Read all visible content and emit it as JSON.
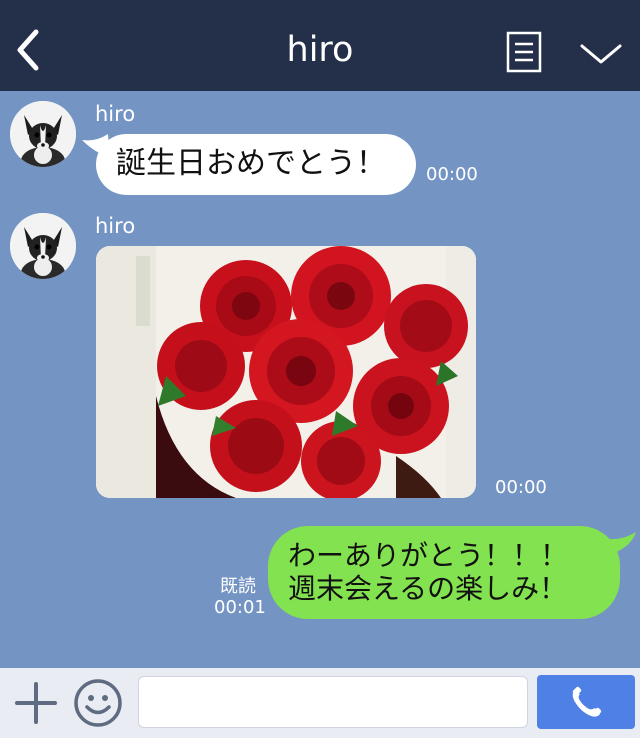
{
  "header": {
    "title": "hiro",
    "back_icon": "chevron-left-icon",
    "menu_icon": "list-icon",
    "collapse_icon": "chevron-down-icon",
    "background": "#243049"
  },
  "chat": {
    "background": "#7494c4",
    "messages": [
      {
        "sender": "hiro",
        "text": "誕生日おめでとう！",
        "time": "00:00"
      },
      {
        "sender": "hiro",
        "image": "red-roses-bouquet",
        "time": "00:00"
      },
      {
        "direction": "outgoing",
        "line1": "わーありがとう！！！",
        "line2": "週末会えるの楽しみ！",
        "read_label": "既読",
        "time": "00:01",
        "bubble_color": "#83e24f"
      }
    ]
  },
  "input_bar": {
    "plus_icon": "plus-icon",
    "emoji_icon": "smiley-icon",
    "input_value": "",
    "call_icon": "phone-icon",
    "call_color": "#4f80e6"
  }
}
